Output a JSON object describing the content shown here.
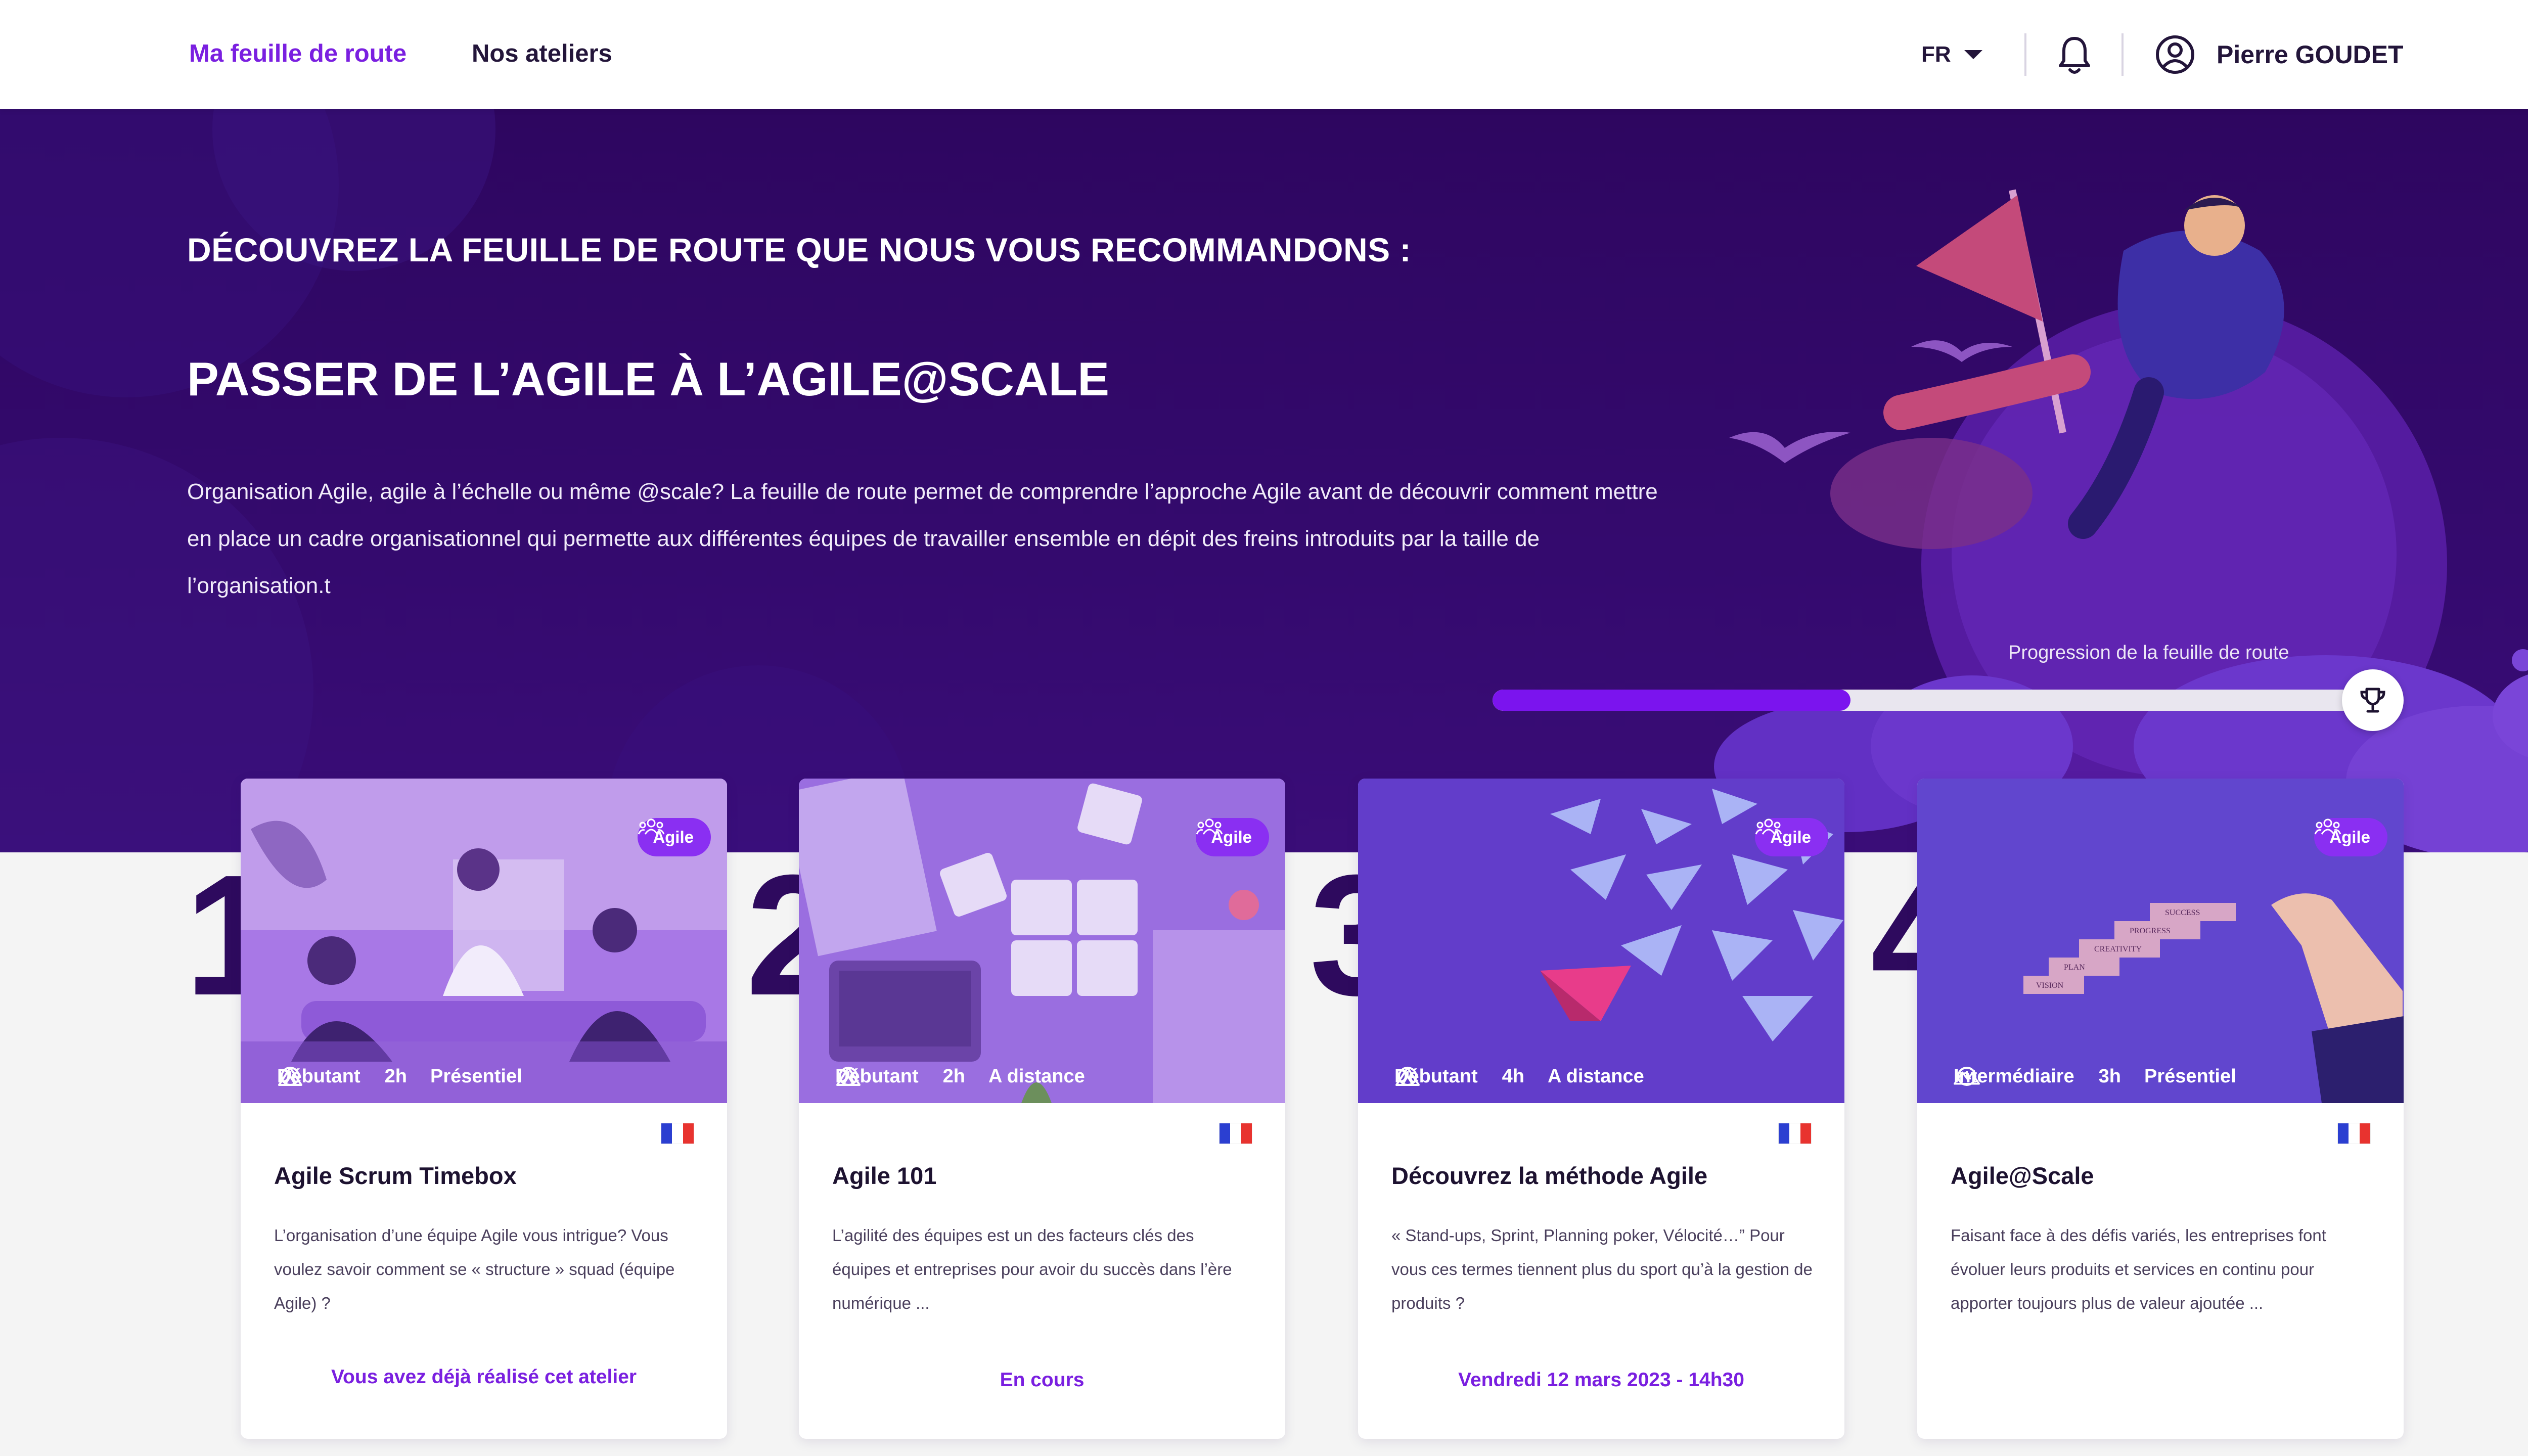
{
  "nav": {
    "links": [
      {
        "label": "Ma feuille de route",
        "active": true
      },
      {
        "label": "Nos ateliers",
        "active": false
      }
    ],
    "language": "FR",
    "user_name": "Pierre GOUDET"
  },
  "hero": {
    "kicker": "DÉCOUVREZ LA FEUILLE DE ROUTE QUE NOUS VOUS RECOMMANDONS :",
    "title": "PASSER DE L’AGILE À L’AGILE@SCALE",
    "description": "Organisation Agile, agile à l’échelle ou même @scale?  La feuille de route permet de comprendre l’approche Agile  avant de découvrir comment mettre en place un cadre organisationnel qui permette aux différentes équipes de travailler ensemble en dépit des freins introduits par la taille de l’organisation.t",
    "progress_label": "Progression de la feuille de route",
    "progress_fraction": 0.4
  },
  "cards": [
    {
      "number": "1",
      "tag": "Agile",
      "level": "Débutant",
      "duration": "2h",
      "mode": "Présentiel",
      "title": "Agile Scrum Timebox",
      "description": "L’organisation d’une équipe Agile vous intrigue? Vous voulez savoir comment se « structure »  squad (équipe Agile) ?",
      "status": "Vous avez déjà réalisé cet atelier"
    },
    {
      "number": "2",
      "tag": "Agile",
      "level": "Débutant",
      "duration": "2h",
      "mode": "A distance",
      "title": "Agile 101",
      "description": "L’agilité des équipes est un des facteurs clés des équipes et entreprises pour avoir du succès dans l’ère numérique ...",
      "status": "En cours"
    },
    {
      "number": "3",
      "tag": "Agile",
      "level": "Débutant",
      "duration": "4h",
      "mode": "A distance",
      "title": "Découvrez la méthode Agile",
      "description": "« Stand-ups, Sprint, Planning poker, Vélocité…” Pour vous ces termes tiennent plus du sport qu’à la gestion de produits ?",
      "status": "Vendredi 12 mars 2023 - 14h30"
    },
    {
      "number": "4",
      "tag": "Agile",
      "level": "Intermédiaire",
      "duration": "3h",
      "mode": "Présentiel",
      "title": "Agile@Scale",
      "description": "Faisant face à des défis variés, les entreprises font évoluer leurs produits et services en continu pour apporter toujours plus de valeur ajoutée ...",
      "status": ""
    }
  ],
  "stairs_words": [
    "SUCCESS",
    "PROGRESS",
    "CREATIVITY",
    "PLAN",
    "VISION"
  ],
  "colors": {
    "accent": "#7a1fe0",
    "hero_bg": "#2e0660",
    "progress": "#7b14ee",
    "tag": "#8a2ff2"
  }
}
